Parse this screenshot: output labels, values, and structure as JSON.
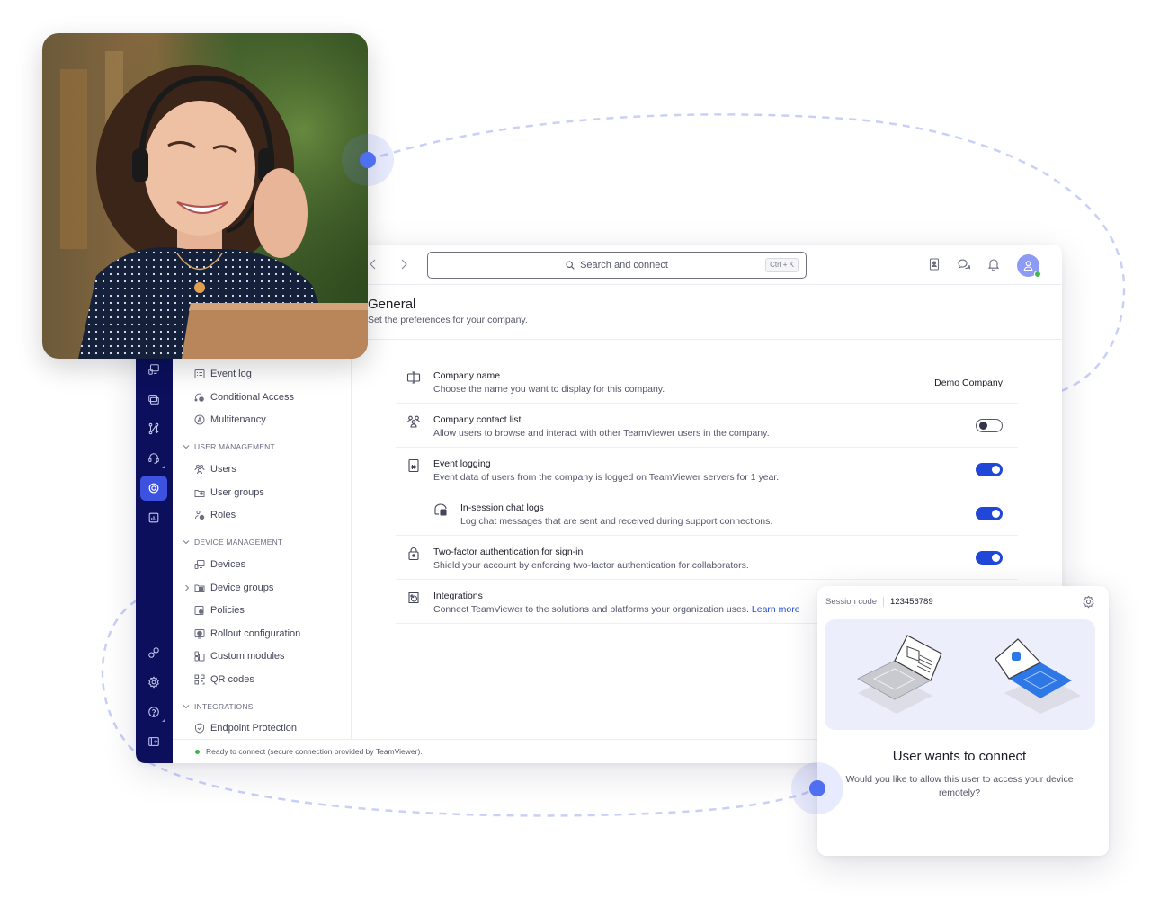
{
  "topbar": {
    "back_label": "Back",
    "forward_label": "Forward",
    "search_placeholder": "Search and connect",
    "search_shortcut": "Ctrl + K",
    "icons": [
      "contacts-book-icon",
      "chat-icon",
      "notification-bell-icon",
      "user-avatar"
    ]
  },
  "page": {
    "title": "General",
    "subtitle": "Set the preferences for your company."
  },
  "settings": [
    {
      "icon": "text-cursor-icon",
      "title": "Company name",
      "description": "Choose the name you want to display for this company.",
      "value": "Demo Company"
    },
    {
      "icon": "group-icon",
      "title": "Company contact list",
      "description": "Allow users to browse and interact with other TeamViewer users in the company.",
      "toggle": false
    },
    {
      "icon": "log-file-icon",
      "title": "Event logging",
      "description": "Event data of users from the company is logged on TeamViewer servers for 1 year.",
      "toggle": true
    },
    {
      "icon": "chat-log-icon",
      "title": "In-session chat logs",
      "description": "Log chat messages that are sent and received during support connections.",
      "toggle": true,
      "nested": true
    },
    {
      "icon": "lock-icon",
      "title": "Two-factor authentication for sign-in",
      "description": "Shield your account by enforcing two-factor authentication for collaborators.",
      "toggle": true
    },
    {
      "icon": "integration-icon",
      "title": "Integrations",
      "description": "Connect TeamViewer to the solutions and platforms your organization uses.",
      "link": "Learn more"
    }
  ],
  "nav": {
    "items_top": [
      {
        "label": "Event log",
        "icon": "event-log-icon"
      },
      {
        "label": "Conditional Access",
        "icon": "conditional-access-icon"
      },
      {
        "label": "Multitenancy",
        "icon": "multitenancy-icon"
      }
    ],
    "sections": [
      {
        "title": "User management",
        "items": [
          {
            "label": "Users",
            "icon": "users-icon"
          },
          {
            "label": "User groups",
            "icon": "user-groups-icon"
          },
          {
            "label": "Roles",
            "icon": "roles-icon"
          }
        ]
      },
      {
        "title": "Device management",
        "items": [
          {
            "label": "Devices",
            "icon": "devices-icon"
          },
          {
            "label": "Device groups",
            "icon": "device-groups-icon",
            "expandable": true
          },
          {
            "label": "Policies",
            "icon": "policies-icon"
          },
          {
            "label": "Rollout configuration",
            "icon": "rollout-icon"
          },
          {
            "label": "Custom modules",
            "icon": "custom-modules-icon"
          },
          {
            "label": "QR codes",
            "icon": "qr-code-icon"
          }
        ]
      },
      {
        "title": "Integrations",
        "items": [
          {
            "label": "Endpoint Protection",
            "icon": "shield-check-icon"
          }
        ]
      }
    ]
  },
  "rail": {
    "icons_top": [
      "remote-devices-icon",
      "sessions-icon",
      "workflow-icon",
      "support-headset-icon",
      "admin-settings-icon",
      "reports-icon"
    ],
    "active_index": 4,
    "icons_bottom": [
      "integrations-icon",
      "settings-icon",
      "help-icon",
      "collapse-sidebar-icon"
    ]
  },
  "status": {
    "text": "Ready to connect (secure connection provided by TeamViewer).",
    "color": "#39b54a"
  },
  "session": {
    "label": "Session code",
    "code": "123456789",
    "title": "User wants to connect",
    "message": "Would you like to allow this user to access your device remotely?"
  },
  "colors": {
    "rail_bg": "#0b0f5c",
    "accent": "#2147d8",
    "link": "#1f4dd8",
    "connector": "#4f6ef0"
  },
  "photo": {
    "description": "Smiling woman with headset working at laptop"
  }
}
